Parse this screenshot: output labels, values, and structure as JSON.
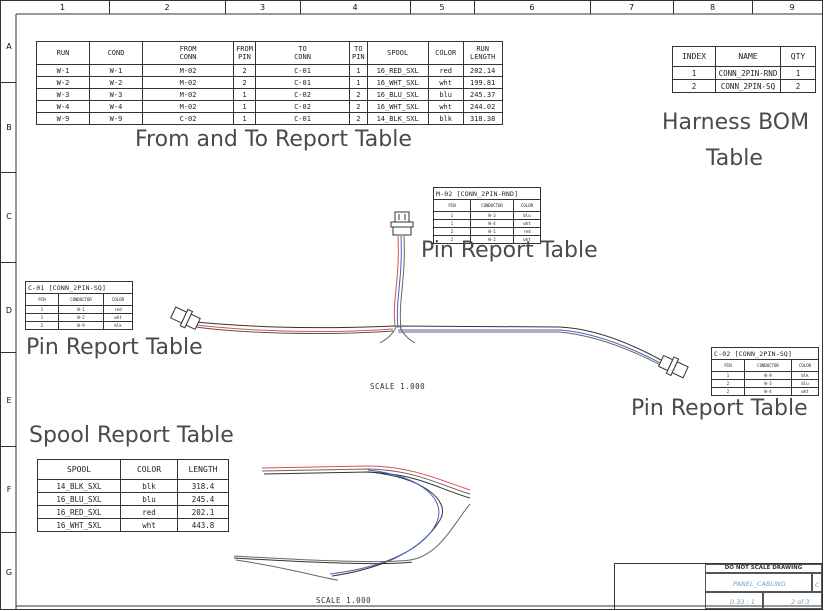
{
  "zones_horizontal": [
    "1",
    "2",
    "3",
    "4",
    "5",
    "6",
    "7",
    "8",
    "9"
  ],
  "zones_vertical": [
    "A",
    "B",
    "C",
    "D",
    "E",
    "F",
    "G"
  ],
  "from_to_table": {
    "headers": [
      "RUN",
      "COND",
      "FROM\nCONN",
      "FROM\nPIN",
      "TO\nCONN",
      "TO\nPIN",
      "SPOOL",
      "COLOR",
      "RUN\nLENGTH"
    ],
    "rows": [
      [
        "W-1",
        "W-1",
        "M-02",
        "2",
        "C-01",
        "1",
        "16_RED_SXL",
        "red",
        "202.14"
      ],
      [
        "W-2",
        "W-2",
        "M-02",
        "2",
        "C-01",
        "1",
        "16_WHT_SXL",
        "wht",
        "199.81"
      ],
      [
        "W-3",
        "W-3",
        "M-02",
        "1",
        "C-02",
        "2",
        "16_BLU_SXL",
        "blu",
        "245.37"
      ],
      [
        "W-4",
        "W-4",
        "M-02",
        "1",
        "C-02",
        "2",
        "16_WHT_SXL",
        "wht",
        "244.02"
      ],
      [
        "W-9",
        "W-9",
        "C-02",
        "1",
        "C-01",
        "2",
        "14_BLK_SXL",
        "blk",
        "318.38"
      ]
    ]
  },
  "bom_table": {
    "headers": [
      "INDEX",
      "NAME",
      "QTY"
    ],
    "rows": [
      [
        "1",
        "CONN_2PIN-RND",
        "1"
      ],
      [
        "2",
        "CONN_2PIN-SQ",
        "2"
      ]
    ]
  },
  "pin_tables": {
    "m02": {
      "title": "M-02 [CONN_2PIN-RND]",
      "headers": [
        "PIN",
        "CONDUCTOR",
        "COLOR"
      ],
      "rows": [
        [
          "1",
          "W-3",
          "blu"
        ],
        [
          "1",
          "W-4",
          "wht"
        ],
        [
          "2",
          "W-1",
          "red"
        ],
        [
          "2",
          "W-2",
          "wht"
        ]
      ]
    },
    "c01": {
      "title": "C-01 [CONN_2PIN-SQ]",
      "headers": [
        "PIN",
        "CONDUCTOR",
        "COLOR"
      ],
      "rows": [
        [
          "1",
          "W-1",
          "red"
        ],
        [
          "1",
          "W-2",
          "wht"
        ],
        [
          "2",
          "W-9",
          "blk"
        ]
      ]
    },
    "c02": {
      "title": "C-02 [CONN_2PIN-SQ]",
      "headers": [
        "PIN",
        "CONDUCTOR",
        "COLOR"
      ],
      "rows": [
        [
          "1",
          "W-9",
          "blk"
        ],
        [
          "2",
          "W-3",
          "blu"
        ],
        [
          "2",
          "W-4",
          "wht"
        ]
      ]
    }
  },
  "spool_table": {
    "headers": [
      "SPOOL",
      "COLOR",
      "LENGTH"
    ],
    "rows": [
      [
        "14_BLK_SXL",
        "blk",
        "318.4"
      ],
      [
        "16_BLU_SXL",
        "blu",
        "245.4"
      ],
      [
        "16_RED_SXL",
        "red",
        "202.1"
      ],
      [
        "16_WHT_SXL",
        "wht",
        "443.8"
      ]
    ]
  },
  "callouts": {
    "from_to": "From and To Report Table",
    "bom_line1": "Harness BOM",
    "bom_line2": "Table",
    "pin_m02": "Pin Report Table",
    "pin_c01": "Pin Report Table",
    "pin_c02": "Pin Report Table",
    "spool": "Spool Report Table"
  },
  "scale_labels": {
    "main": "SCALE  1.000",
    "bottom": "SCALE  1.000"
  },
  "title_block": {
    "note": "DO NOT SCALE DRAWING",
    "drawing_name": "PANEL_CABLING",
    "size": "C",
    "scale": "0.33 : 1",
    "sheet": "2 of 3"
  },
  "colors": {
    "wire_red": "#d9534f",
    "wire_blue": "#4a5fc1",
    "wire_black": "#333333",
    "callout_text": "#4a4a4a",
    "title_block_text": "#6da0d0"
  }
}
